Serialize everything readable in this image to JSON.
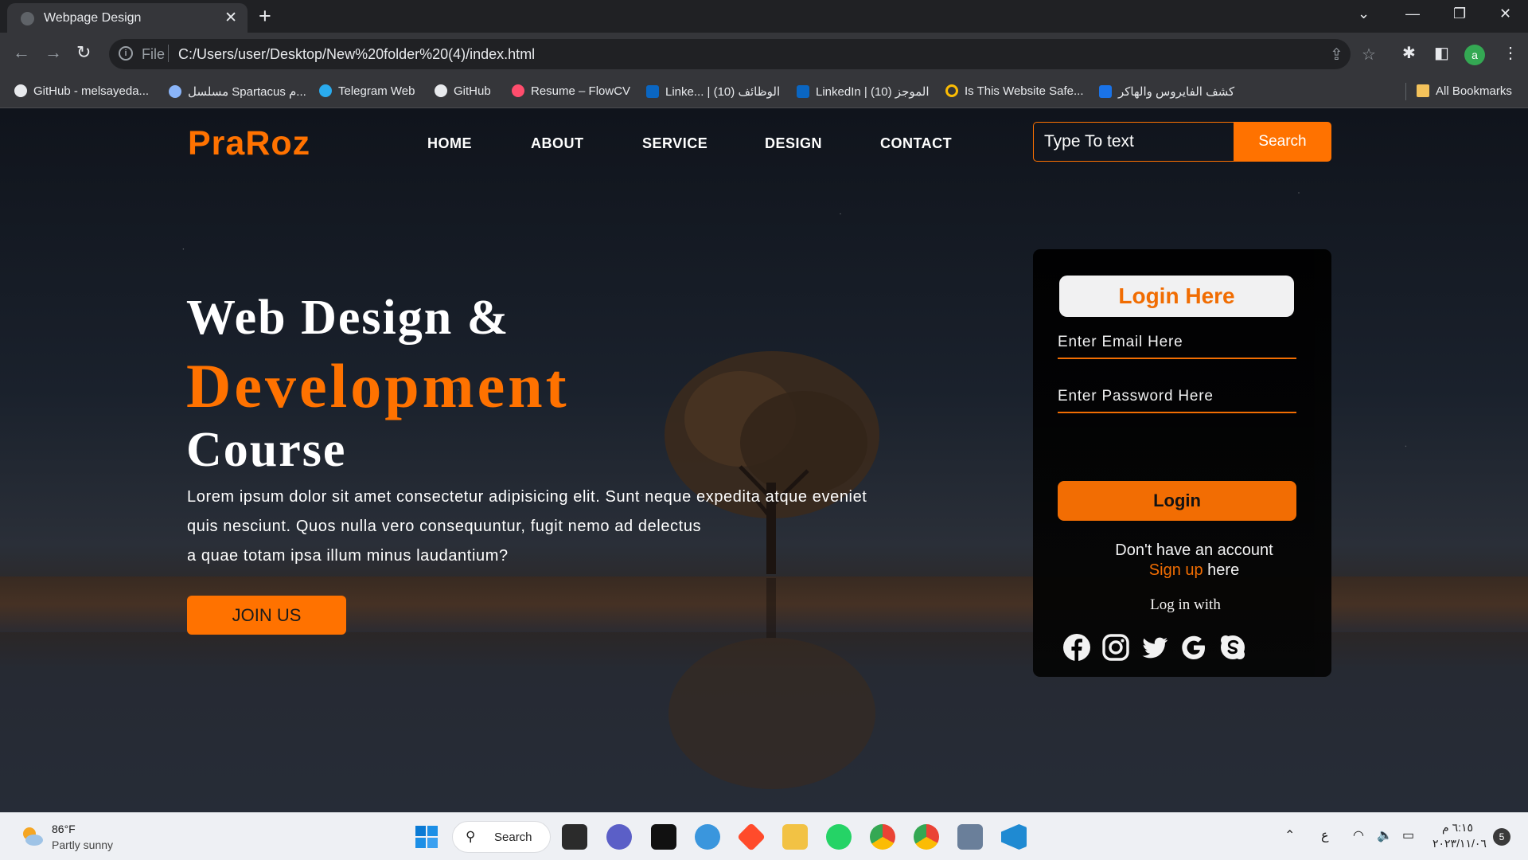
{
  "browser": {
    "tab_title": "Webpage Design",
    "url_scheme": "File",
    "url": "C:/Users/user/Desktop/New%20folder%20(4)/index.html",
    "profile_initial": "a",
    "bookmarks": [
      {
        "label": "GitHub - melsayeda...",
        "icon": "github-icon",
        "color": "#e8eaed"
      },
      {
        "label": "مسلسل Spartacus م...",
        "icon": "location-pin-icon",
        "color": "#8ab4f8"
      },
      {
        "label": "Telegram Web",
        "icon": "telegram-icon",
        "color": "#2aabee"
      },
      {
        "label": "GitHub",
        "icon": "github-icon",
        "color": "#e8eaed"
      },
      {
        "label": "Resume – FlowCV",
        "icon": "flowcv-icon",
        "color": "#ff4d6d"
      },
      {
        "label": "Linke... | الوظائف (10)",
        "icon": "linkedin-icon",
        "color": "#0a66c2"
      },
      {
        "label": "LinkedIn | الموجز (10)",
        "icon": "linkedin-icon",
        "color": "#0a66c2"
      },
      {
        "label": "Is This Website Safe...",
        "icon": "safe-check-icon",
        "color": "#fbbc04"
      },
      {
        "label": "كشف الفايروس والهاكر",
        "icon": "virus-scan-icon",
        "color": "#1a73e8"
      }
    ],
    "all_bookmarks": "All Bookmarks"
  },
  "site": {
    "logo": "PraRoz",
    "nav": [
      "HOME",
      "ABOUT",
      "SERVICE",
      "DESIGN",
      "CONTACT"
    ],
    "search_placeholder": "Type To text",
    "search_button": "Search",
    "accent": "#ff7200"
  },
  "hero": {
    "line1": "Web Design &",
    "line2": "Development",
    "line3": "Course",
    "paragraph_lines": [
      "Lorem ipsum dolor sit amet consectetur adipisicing elit. Sunt neque expedita atque eveniet",
      "quis nesciunt. Quos nulla vero consequuntur, fugit nemo ad delectus",
      "a quae totam ipsa illum minus laudantium?"
    ],
    "join_button": "JOIN US"
  },
  "login": {
    "heading": "Login Here",
    "email_placeholder": "Enter Email Here",
    "password_placeholder": "Enter Password Here",
    "button": "Login",
    "no_account": "Don't have an account",
    "signup_link": "Sign up",
    "signup_suffix": " here",
    "login_with": "Log in with",
    "socials": [
      "facebook-icon",
      "instagram-icon",
      "twitter-icon",
      "google-icon",
      "skype-icon"
    ]
  },
  "taskbar": {
    "temperature": "86°F",
    "weather": "Partly sunny",
    "search_label": "Search",
    "input_indicator": "ع",
    "time": "٦:١٥ م",
    "date": "٢٠٢٣/١١/٠٦",
    "notifications": "5"
  }
}
